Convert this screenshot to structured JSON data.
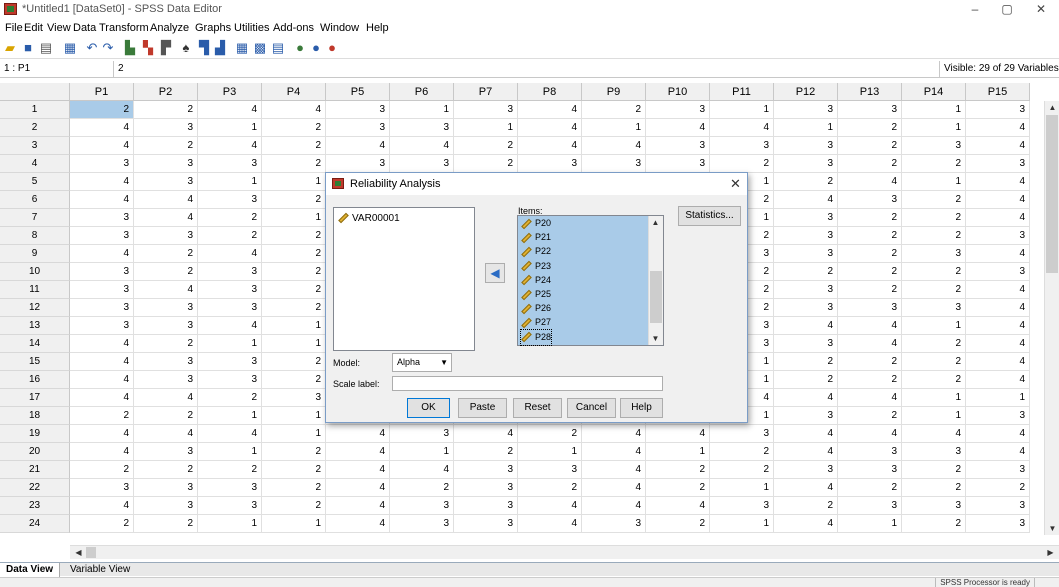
{
  "window": {
    "title": "*Untitled1 [DataSet0] - SPSS Data Editor",
    "min": "–",
    "max": "▢",
    "close": "✕"
  },
  "menu": [
    "File",
    "Edit",
    "View",
    "Data",
    "Transform",
    "Analyze",
    "Graphs",
    "Utilities",
    "Add-ons",
    "Window",
    "Help"
  ],
  "cellbar": {
    "ref": "1 : P1",
    "value": "2",
    "visible": "Visible: 29 of 29 Variables"
  },
  "columns": [
    "P1",
    "P2",
    "P3",
    "P4",
    "P5",
    "P6",
    "P7",
    "P8",
    "P9",
    "P10",
    "P11",
    "P12",
    "P13",
    "P14",
    "P15"
  ],
  "rows": [
    [
      2,
      2,
      4,
      4,
      3,
      1,
      3,
      4,
      2,
      3,
      1,
      3,
      3,
      1,
      3
    ],
    [
      4,
      3,
      1,
      2,
      3,
      3,
      1,
      4,
      1,
      4,
      4,
      1,
      2,
      1,
      4
    ],
    [
      4,
      2,
      4,
      2,
      4,
      4,
      2,
      4,
      4,
      3,
      3,
      3,
      2,
      3,
      4
    ],
    [
      3,
      3,
      3,
      2,
      3,
      3,
      2,
      3,
      3,
      3,
      2,
      3,
      2,
      2,
      3
    ],
    [
      4,
      3,
      1,
      1,
      "",
      "",
      "",
      "",
      "",
      "",
      1,
      2,
      4,
      1,
      4
    ],
    [
      4,
      4,
      3,
      2,
      "",
      "",
      "",
      "",
      "",
      "",
      2,
      4,
      3,
      2,
      4
    ],
    [
      3,
      4,
      2,
      1,
      "",
      "",
      "",
      "",
      "",
      "",
      1,
      3,
      2,
      2,
      4
    ],
    [
      3,
      3,
      2,
      2,
      "",
      "",
      "",
      "",
      "",
      "",
      2,
      3,
      2,
      2,
      3
    ],
    [
      4,
      2,
      4,
      2,
      "",
      "",
      "",
      "",
      "",
      "",
      3,
      3,
      2,
      3,
      4
    ],
    [
      3,
      2,
      3,
      2,
      "",
      "",
      "",
      "",
      "",
      "",
      2,
      2,
      2,
      2,
      3
    ],
    [
      3,
      4,
      3,
      2,
      "",
      "",
      "",
      "",
      "",
      "",
      2,
      3,
      2,
      2,
      4
    ],
    [
      3,
      3,
      3,
      2,
      "",
      "",
      "",
      "",
      "",
      "",
      2,
      3,
      3,
      3,
      4
    ],
    [
      3,
      3,
      4,
      1,
      "",
      "",
      "",
      "",
      "",
      "",
      3,
      4,
      4,
      1,
      4
    ],
    [
      4,
      2,
      1,
      1,
      "",
      "",
      "",
      "",
      "",
      "",
      3,
      3,
      4,
      2,
      4
    ],
    [
      4,
      3,
      3,
      2,
      "",
      "",
      "",
      "",
      "",
      "",
      1,
      2,
      2,
      2,
      4
    ],
    [
      4,
      3,
      3,
      2,
      "",
      "",
      "",
      "",
      "",
      "",
      1,
      2,
      2,
      2,
      4
    ],
    [
      4,
      4,
      2,
      3,
      "",
      "",
      "",
      "",
      "",
      "",
      4,
      4,
      4,
      1,
      1
    ],
    [
      2,
      2,
      1,
      1,
      "",
      "",
      "",
      "",
      "",
      "",
      1,
      3,
      2,
      1,
      3
    ],
    [
      4,
      4,
      4,
      1,
      4,
      3,
      4,
      2,
      4,
      4,
      3,
      4,
      4,
      4,
      4
    ],
    [
      4,
      3,
      1,
      2,
      4,
      1,
      2,
      1,
      4,
      1,
      2,
      4,
      3,
      3,
      4
    ],
    [
      2,
      2,
      2,
      2,
      4,
      4,
      3,
      3,
      4,
      2,
      2,
      3,
      3,
      2,
      3
    ],
    [
      3,
      3,
      3,
      2,
      4,
      2,
      3,
      2,
      4,
      2,
      1,
      4,
      2,
      2,
      2
    ],
    [
      4,
      3,
      3,
      2,
      4,
      3,
      3,
      4,
      4,
      4,
      3,
      2,
      3,
      3,
      3
    ],
    [
      2,
      2,
      1,
      1,
      4,
      3,
      3,
      4,
      3,
      2,
      1,
      4,
      1,
      2,
      3
    ]
  ],
  "dialog": {
    "title": "Reliability Analysis",
    "close": "✕",
    "source_vars": [
      "VAR00001"
    ],
    "items_label": "Items:",
    "items": [
      "P20",
      "P21",
      "P22",
      "P23",
      "P24",
      "P25",
      "P26",
      "P27",
      "P28"
    ],
    "statistics_btn": "Statistics...",
    "model_label": "Model:",
    "model_value": "Alpha",
    "scale_label": "Scale label:",
    "scale_value": "",
    "buttons": {
      "ok": "OK",
      "paste": "Paste",
      "reset": "Reset",
      "cancel": "Cancel",
      "help": "Help"
    }
  },
  "tabs": {
    "data_view": "Data View",
    "variable_view": "Variable View"
  },
  "status": "SPSS Processor is ready"
}
